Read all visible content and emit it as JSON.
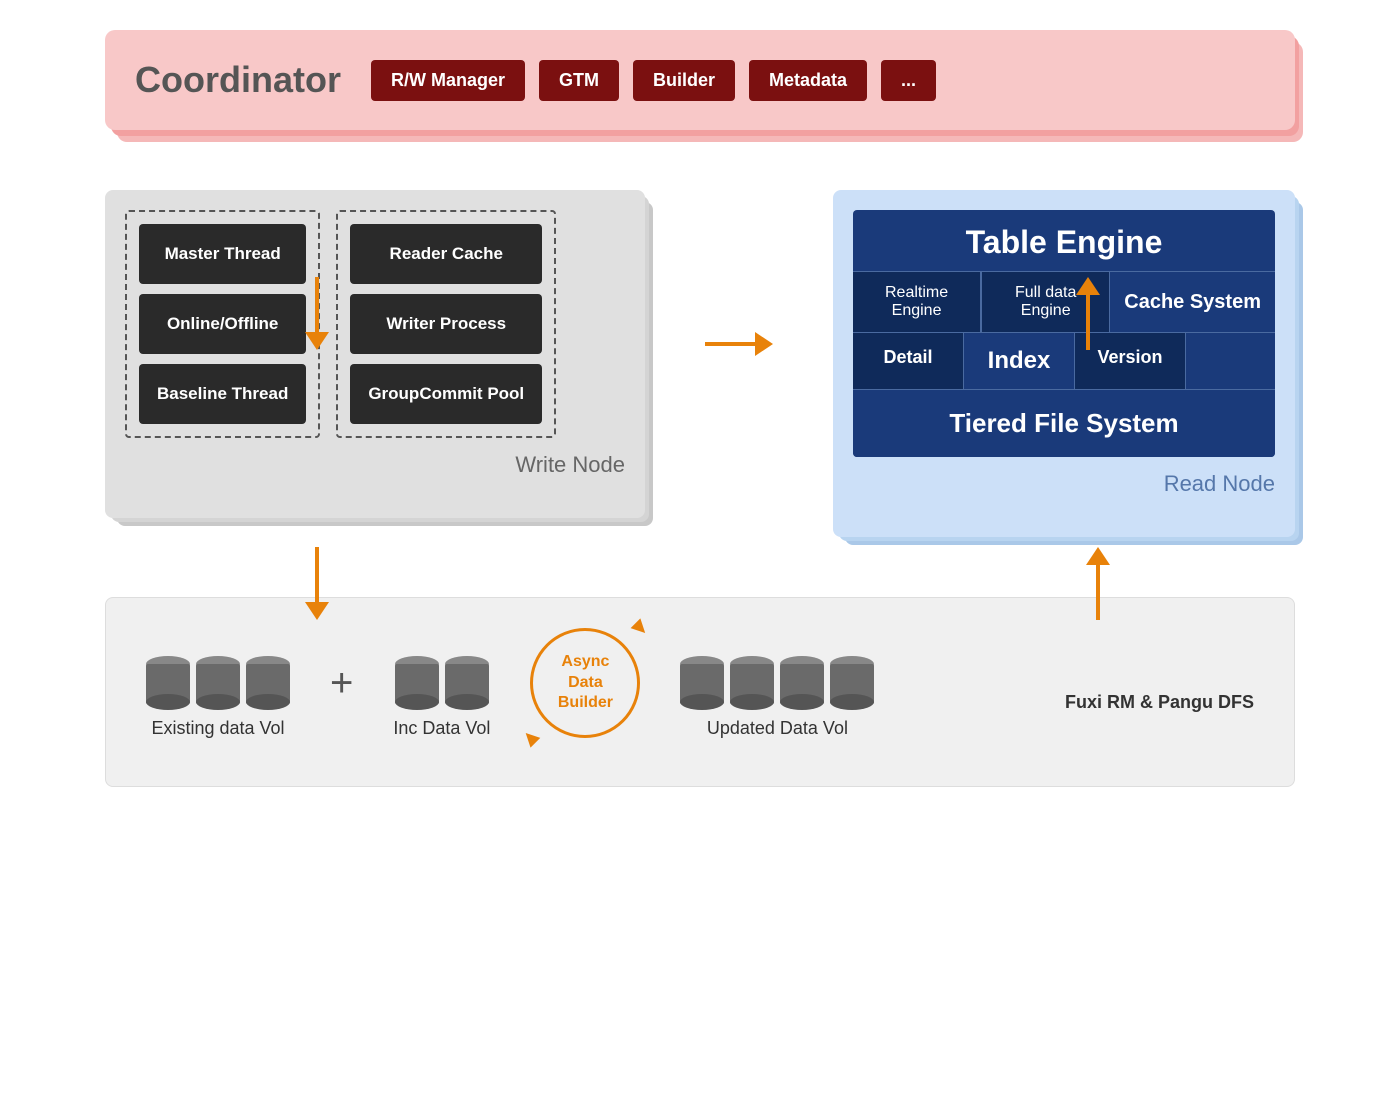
{
  "coordinator": {
    "title": "Coordinator",
    "badges": [
      "R/W Manager",
      "GTM",
      "Builder",
      "Metadata",
      "..."
    ]
  },
  "writeNode": {
    "label": "Write Node",
    "leftColumn": [
      "Master Thread",
      "Online/Offline",
      "Baseline Thread"
    ],
    "rightColumn": [
      "Reader Cache",
      "Writer Process",
      "GroupCommit Pool"
    ]
  },
  "readNode": {
    "label": "Read Node",
    "tableEngineTitle": "Table Engine",
    "row1": {
      "realtimeEngine": "Realtime Engine",
      "fullDataEngine": "Full data Engine",
      "cacheSystem": "Cache System"
    },
    "row2": {
      "detail": "Detail",
      "index": "Index",
      "version": "Version"
    },
    "tieredFs": "Tiered File System"
  },
  "bottom": {
    "existingLabel": "Existing data Vol",
    "incLabel": "Inc Data Vol",
    "updatedLabel": "Updated Data Vol",
    "asyncLabel": "Async\nData\nBuilder",
    "footerLabel": "Fuxi RM & Pangu DFS",
    "plus": "+"
  }
}
